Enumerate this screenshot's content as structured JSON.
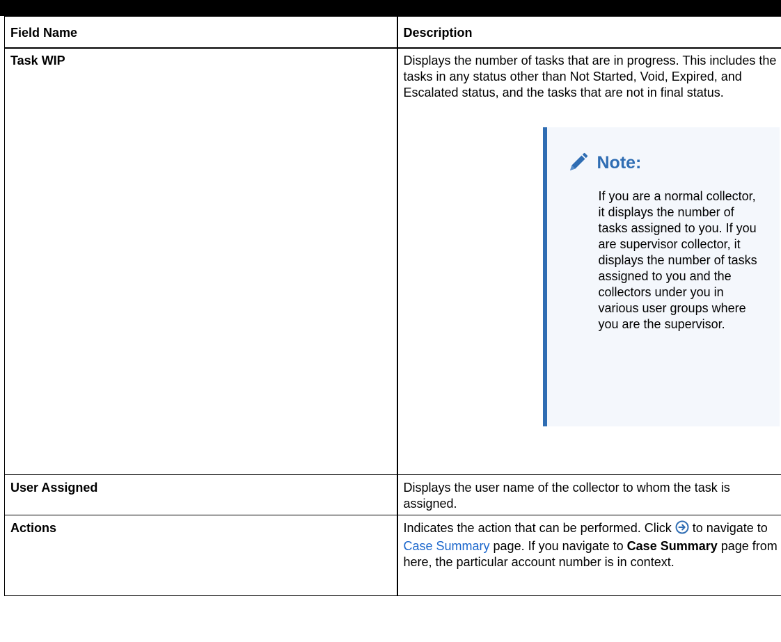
{
  "table": {
    "headers": {
      "field": "Field Name",
      "description": "Description"
    },
    "rows": [
      {
        "name": "Task WIP",
        "description": "Displays the number of tasks that are in progress. This includes the tasks in any status other than Not Started, Void, Expired, and Escalated status, and the tasks that are not in final status.",
        "note": {
          "title": "Note:",
          "body": "If you are a normal collector, it displays the number of tasks assigned to you. If you are supervisor collector, it displays the number of tasks assigned to you and the collectors under you in various user groups where you are the supervisor."
        }
      },
      {
        "name": "User Assigned",
        "description": "Displays the user name of the collector to whom the task is assigned."
      },
      {
        "name": "Actions",
        "description_parts": {
          "pre": "Indicates the action that can be performed. Click ",
          "post_icon": " to navigate to ",
          "link": "Case Summary",
          "mid": " page. If you navigate to ",
          "bold": "Case Summary",
          "end": " page from here, the particular account number is in context."
        }
      }
    ]
  },
  "colors": {
    "note_accent": "#2f6db3",
    "note_background": "#f4f7fc",
    "link": "#1a66cc"
  },
  "icons": {
    "note": "pencil-icon",
    "navigate": "arrow-circle-right-icon"
  }
}
